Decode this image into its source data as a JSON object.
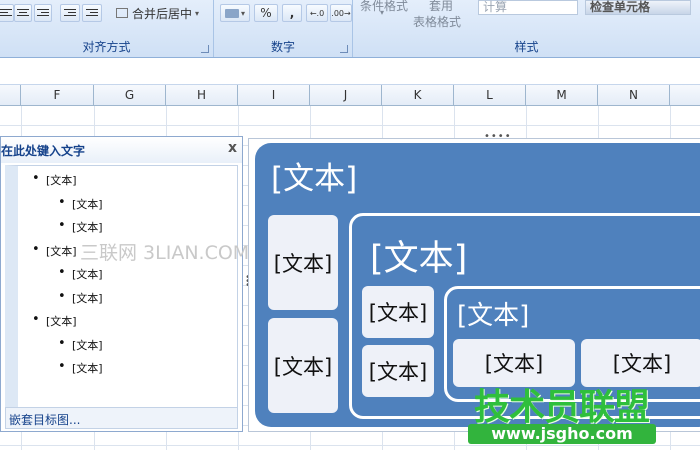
{
  "ribbon": {
    "merge_label": "合并后居中",
    "group_alignment": "对齐方式",
    "group_number": "数字",
    "group_styles": "样式",
    "percent_symbol": "%",
    "comma_symbol": ",",
    "cond_format": "条件格式",
    "apply": "套用",
    "table_format": "表格格式",
    "calc_label": "计算",
    "check_cell": "检查单元格"
  },
  "columns": [
    "F",
    "G",
    "H",
    "I",
    "J",
    "K",
    "L",
    "M",
    "N"
  ],
  "text_pane": {
    "title": "在此处键入文字",
    "close": "x",
    "items": [
      {
        "level": 1,
        "text": "[文本]"
      },
      {
        "level": 2,
        "text": "[文本]"
      },
      {
        "level": 2,
        "text": "[文本]"
      },
      {
        "level": 1,
        "text": "[文本]"
      },
      {
        "level": 2,
        "text": "[文本]"
      },
      {
        "level": 2,
        "text": "[文本]"
      },
      {
        "level": 1,
        "text": "[文本]"
      },
      {
        "level": 2,
        "text": "[文本]"
      },
      {
        "level": 2,
        "text": "[文本]"
      }
    ],
    "footer": "嵌套目标图..."
  },
  "smartart": {
    "outer_label": "[文本]",
    "left_box_1": "[文本]",
    "left_box_2": "[文本]",
    "mid_label": "[文本]",
    "mid_box_1": "[文本]",
    "mid_box_2": "[文本]",
    "inner_label": "[文本]",
    "inner_box_1": "[文本]",
    "inner_box_2": "[文本]"
  },
  "watermarks": {
    "sanlian": "三联网 3LIAN.COM",
    "jishuyuan": "技术员联盟",
    "url": "www.jsgho.com"
  },
  "colors": {
    "smartart_fill": "#4f81bd",
    "ribbon_text": "#15428b",
    "logo_green": "#2fbf3c"
  }
}
